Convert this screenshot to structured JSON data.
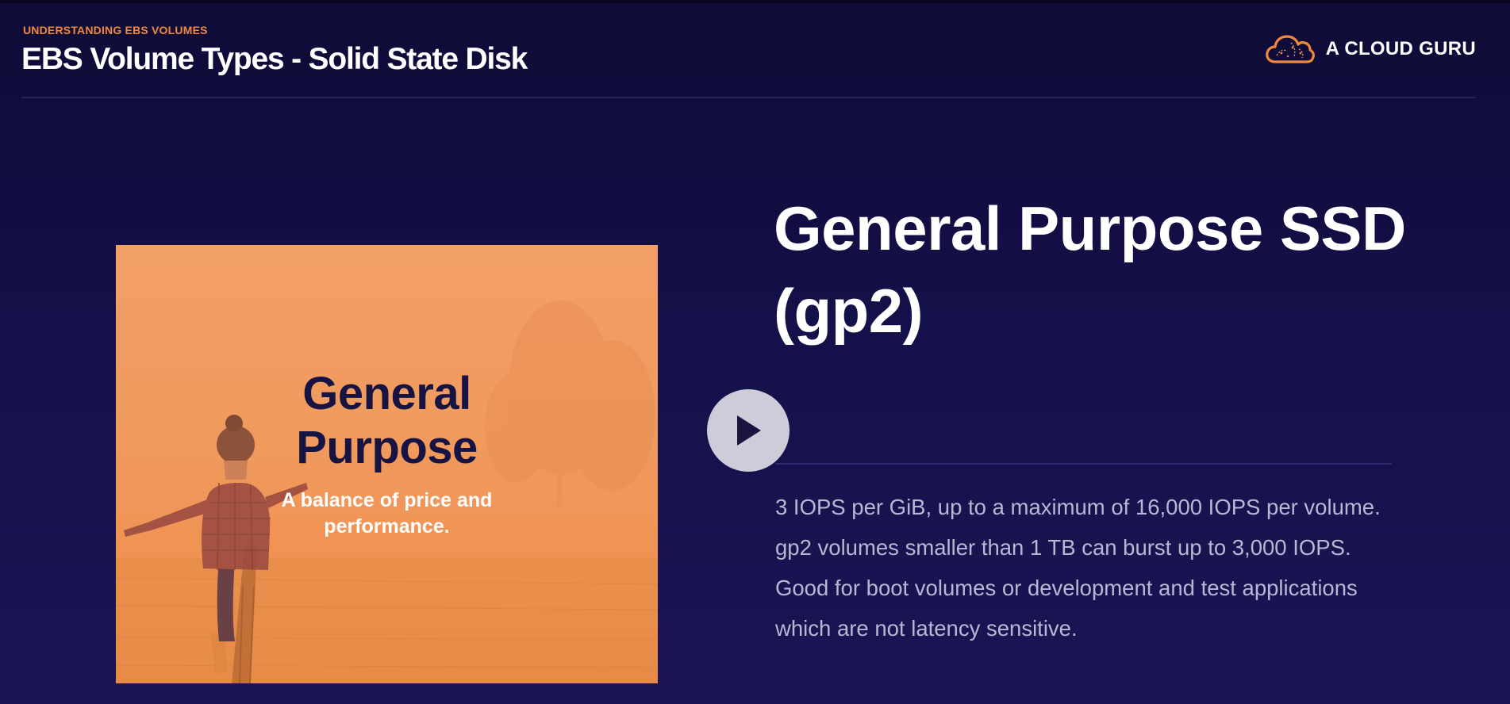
{
  "header": {
    "eyebrow": "UNDERSTANDING EBS VOLUMES",
    "title": "EBS Volume Types - Solid State Disk"
  },
  "brand": {
    "name": "A CLOUD GURU",
    "logo_icon": "cloud-logo-icon",
    "accent_color": "#f0883d"
  },
  "card": {
    "title_line1": "General",
    "title_line2": "Purpose",
    "subtitle_line1": "A balance of price and",
    "subtitle_line2": "performance.",
    "overlay_color": "#f09a5e"
  },
  "player": {
    "play_icon": "play-icon"
  },
  "content": {
    "headline_line1": "General Purpose SSD",
    "headline_line2": "(gp2)",
    "description_lines": [
      "3 IOPS per GiB, up to a maximum of 16,000 IOPS per volume.",
      "gp2 volumes smaller than 1 TB can burst up to 3,000 IOPS.",
      "Good for boot volumes or development and test applications",
      "which are not latency sensitive."
    ]
  },
  "colors": {
    "background": "#141049",
    "title_text": "#ffffff",
    "body_text": "#b9b7d3",
    "card_heading": "#171443"
  }
}
